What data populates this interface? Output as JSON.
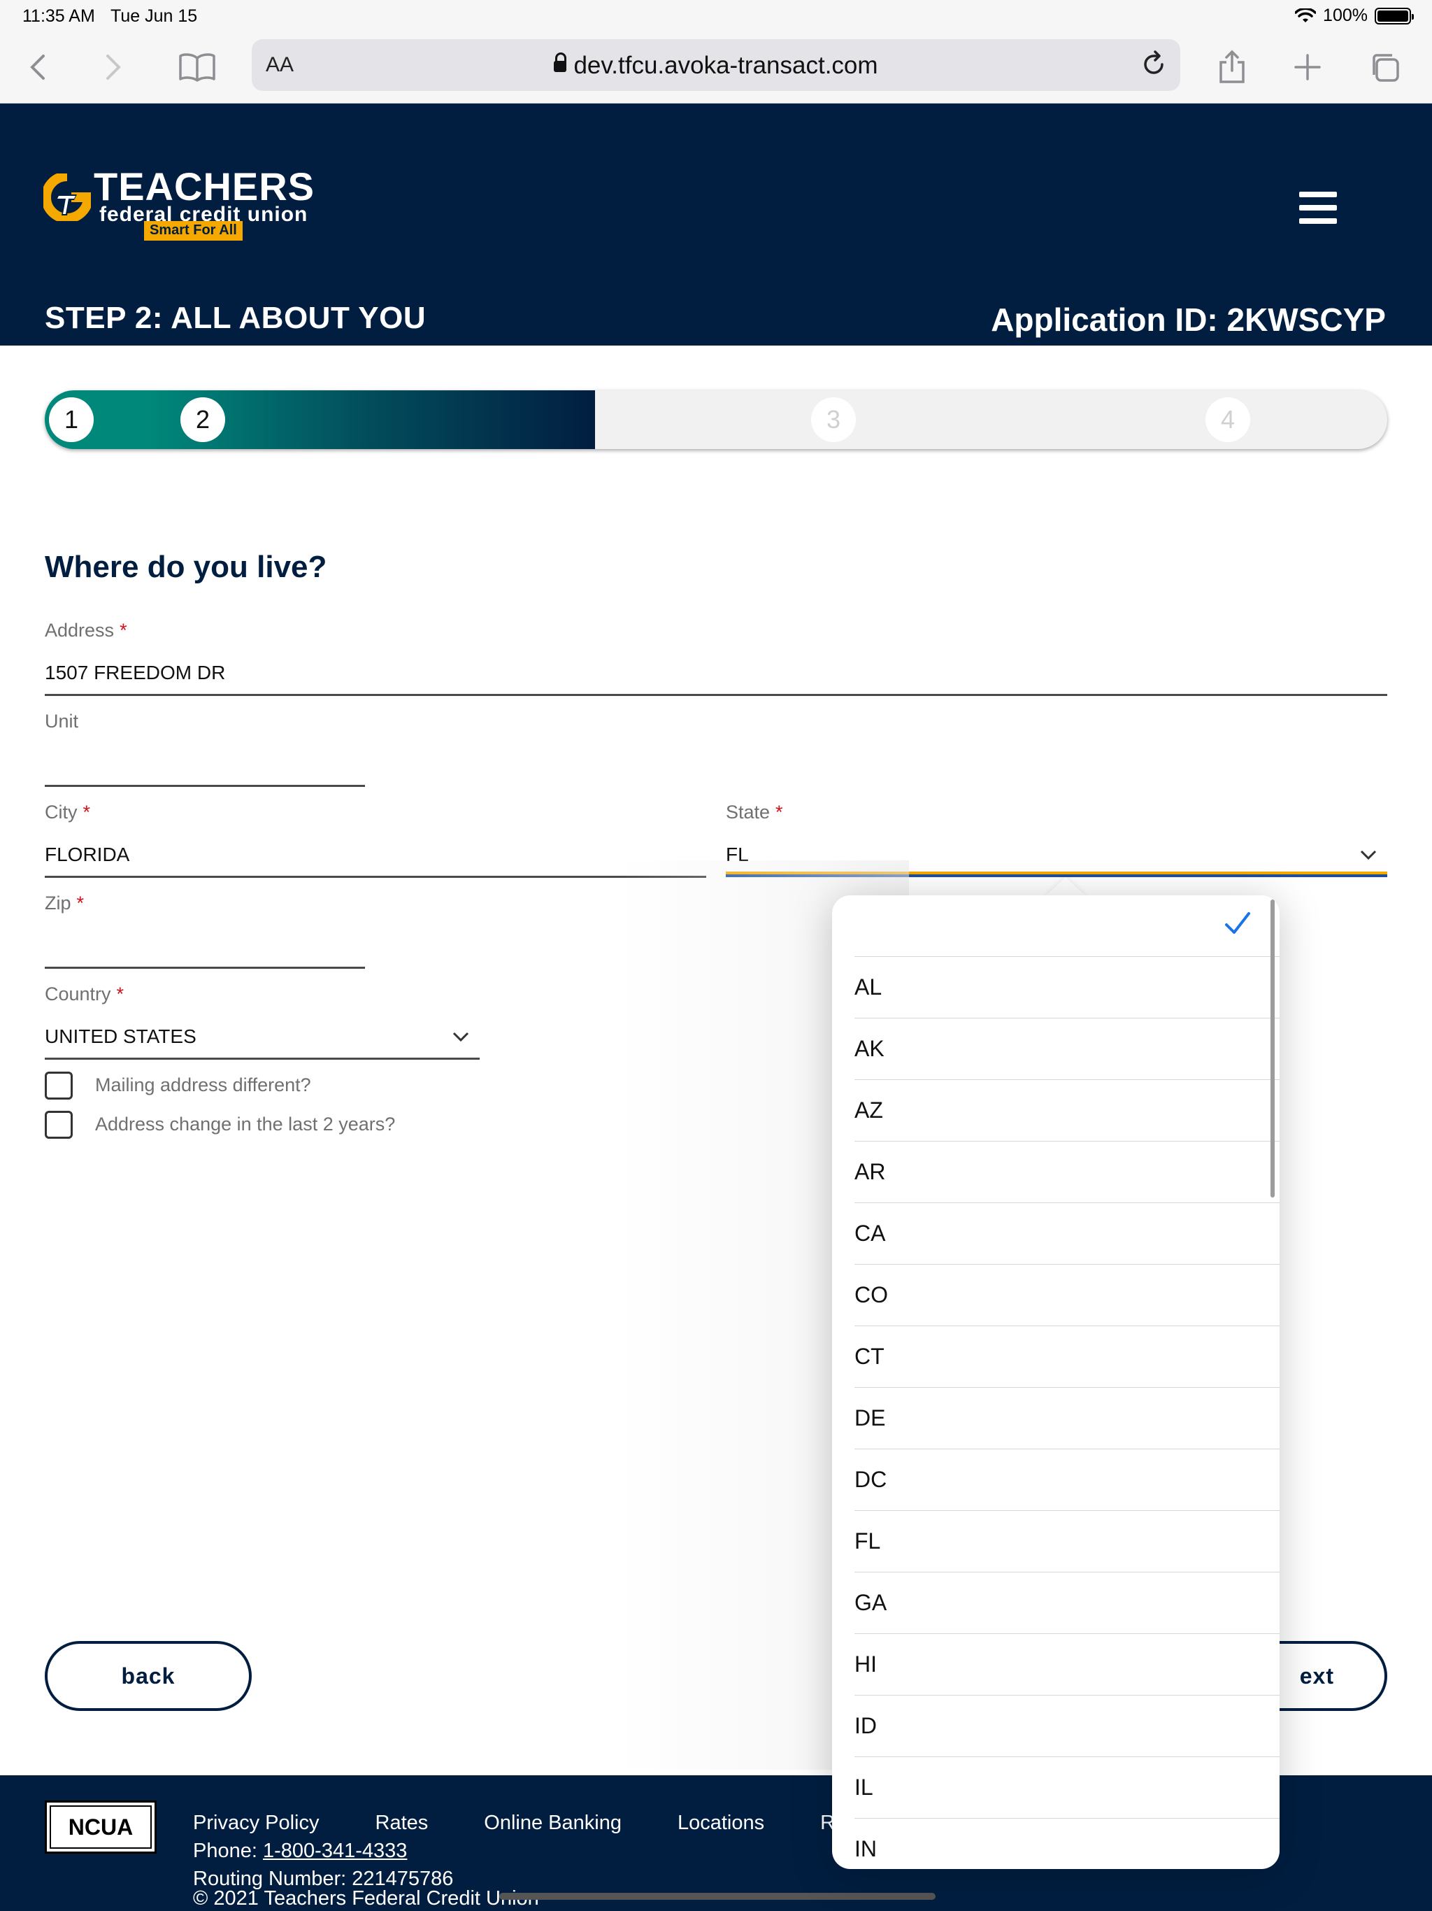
{
  "status_bar": {
    "time": "11:35 AM",
    "date": "Tue Jun 15",
    "battery": "100%"
  },
  "browser": {
    "text_size": "AA",
    "url": "dev.tfcu.avoka-transact.com"
  },
  "header": {
    "logo_title": "TEACHERS",
    "logo_subtitle": "federal credit union",
    "logo_tagline": "Smart For All",
    "step_title": "STEP 2: ALL ABOUT YOU",
    "application_id": "Application ID: 2KWSCYP"
  },
  "progress": {
    "steps": [
      "1",
      "2",
      "3",
      "4"
    ],
    "current": 2,
    "completed_fraction": 0.41
  },
  "form": {
    "section_title": "Where do you live?",
    "required_mark": "*",
    "address": {
      "label": "Address",
      "value": "1507 FREEDOM DR"
    },
    "unit": {
      "label": "Unit",
      "value": ""
    },
    "city": {
      "label": "City",
      "value": "FLORIDA"
    },
    "state": {
      "label": "State",
      "value": "FL"
    },
    "zip": {
      "label": "Zip",
      "value": ""
    },
    "country": {
      "label": "Country",
      "value": "UNITED STATES"
    },
    "mailing_different": "Mailing address different?",
    "address_change": "Address change in the last 2 years?"
  },
  "buttons": {
    "back": "back",
    "next_visible": "ext"
  },
  "state_picker": {
    "options": [
      "",
      "AL",
      "AK",
      "AZ",
      "AR",
      "CA",
      "CO",
      "CT",
      "DE",
      "DC",
      "FL",
      "GA",
      "HI",
      "ID",
      "IL",
      "IN"
    ],
    "checked_index": 0
  },
  "footer": {
    "links": [
      "Privacy Policy",
      "Rates",
      "Online Banking",
      "Locations",
      "Res"
    ],
    "phone_label": "Phone: ",
    "phone": "1-800-341-4333",
    "routing": "Routing Number: 221475786",
    "copyright": "© 2021 Teachers Federal Credit Union",
    "ncua": "NCUA"
  },
  "colors": {
    "navy": "#011e41",
    "teal": "#00897b",
    "gold": "#f5a800",
    "required": "#d3131c",
    "ios_blue": "#1a73e8"
  }
}
